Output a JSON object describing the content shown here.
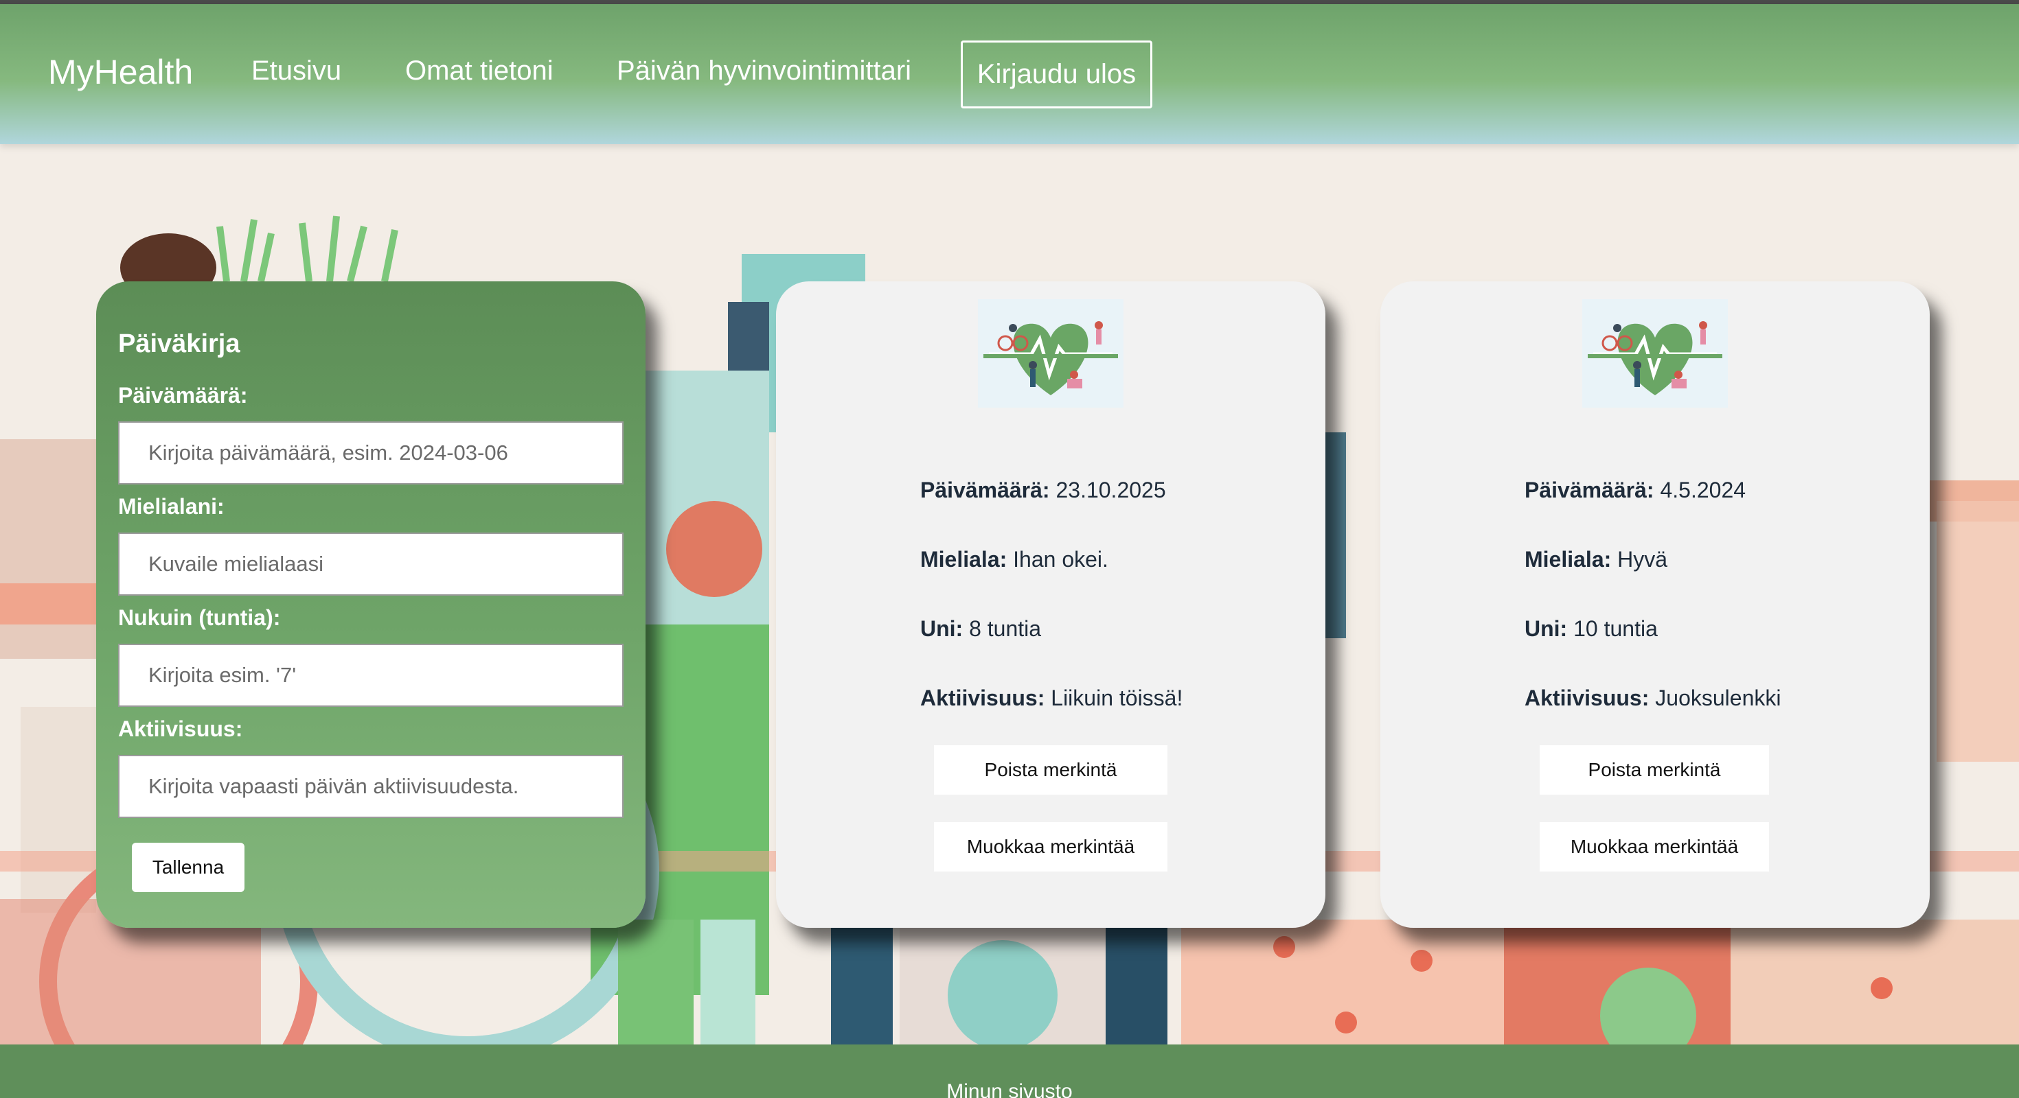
{
  "header": {
    "brand": "MyHealth",
    "nav": [
      "Etusivu",
      "Omat tietoni",
      "Päivän hyvinvointimittari"
    ],
    "logout_label": "Kirjaudu ulos"
  },
  "diary_form": {
    "title": "Päiväkirja",
    "fields": [
      {
        "label": "Päivämäärä:",
        "placeholder": "Kirjoita päivämäärä, esim. 2024-03-06"
      },
      {
        "label": "Mielialani:",
        "placeholder": "Kuvaile mielialaasi"
      },
      {
        "label": "Nukuin (tuntia):",
        "placeholder": "Kirjoita esim. '7'"
      },
      {
        "label": "Aktiivisuus:",
        "placeholder": "Kirjoita vapaasti päivän aktiivisuudesta."
      }
    ],
    "save_label": "Tallenna"
  },
  "entries": [
    {
      "date_label": "Päivämäärä:",
      "date": "23.10.2025",
      "mood_label": "Mieliala:",
      "mood": "Ihan okei.",
      "sleep_label": "Uni:",
      "sleep": "8 tuntia",
      "activity_label": "Aktiivisuus:",
      "activity": "Liikuin töissä!",
      "delete_label": "Poista merkintä",
      "edit_label": "Muokkaa merkintää"
    },
    {
      "date_label": "Päivämäärä:",
      "date": "4.5.2024",
      "mood_label": "Mieliala:",
      "mood": "Hyvä",
      "sleep_label": "Uni:",
      "sleep": "10 tuntia",
      "activity_label": "Aktiivisuus:",
      "activity": "Juoksulenkki",
      "delete_label": "Poista merkintä",
      "edit_label": "Muokkaa merkintää"
    }
  ],
  "footer": {
    "text": "Minun sivusto"
  },
  "colors": {
    "header_green": "#6ea36b",
    "form_green": "#5c8d56",
    "footer_green": "#5f8f5a",
    "card_bg": "#f2f2f2"
  }
}
